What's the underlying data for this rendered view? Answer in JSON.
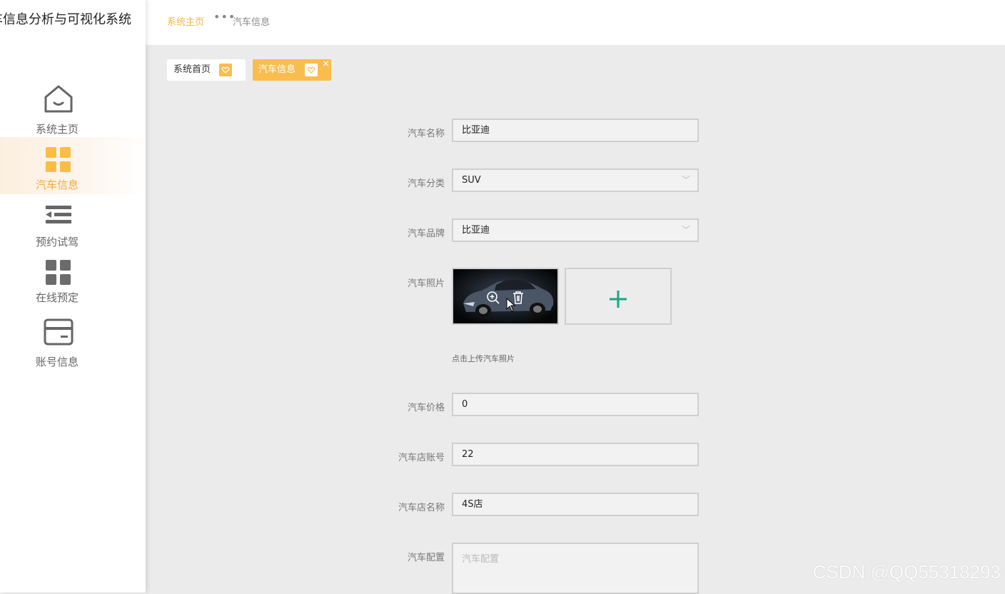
{
  "sidebar": {
    "app_title": "车信息分析与可视化系统",
    "items": [
      {
        "label": "系统主页",
        "icon": "home-icon"
      },
      {
        "label": "汽车信息",
        "icon": "grid-icon",
        "active": true
      },
      {
        "label": "预约试驾",
        "icon": "list-indent-icon"
      },
      {
        "label": "在线预定",
        "icon": "grid-icon"
      },
      {
        "label": "账号信息",
        "icon": "card-icon"
      }
    ]
  },
  "header": {
    "breadcrumb_home": "系统主页",
    "breadcrumb_sep": "•••",
    "breadcrumb_current": "汽车信息"
  },
  "tags": [
    {
      "label": "系统首页"
    },
    {
      "label": "汽车信息",
      "active": true,
      "close": "×"
    }
  ],
  "form": {
    "name_label": "汽车名称",
    "name_value": "比亚迪",
    "category_label": "汽车分类",
    "category_value": "SUV",
    "brand_label": "汽车品牌",
    "brand_value": "比亚迪",
    "photo_label": "汽车照片",
    "photo_hint": "点击上传汽车照片",
    "price_label": "汽车价格",
    "price_value": "0",
    "shop_account_label": "汽车店账号",
    "shop_account_value": "22",
    "shop_name_label": "汽车店名称",
    "shop_name_value": "4S店",
    "config_label": "汽车配置",
    "config_placeholder": "汽车配置"
  },
  "watermark": "CSDN @QQ55318293",
  "colors": {
    "accent": "#f9bd4e",
    "active_text": "#f5a93a",
    "upload_plus": "#1ca585",
    "background": "#ebebeb"
  }
}
